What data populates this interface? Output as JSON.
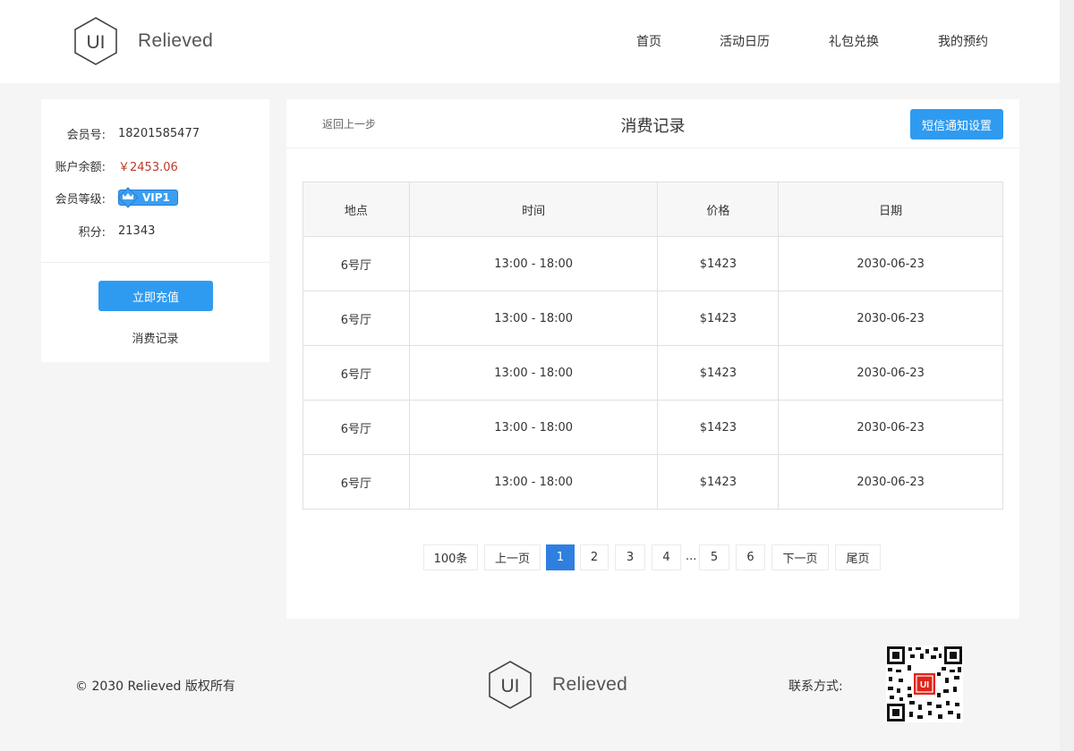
{
  "header": {
    "logo_mark": "UI",
    "logo_text": "Relieved",
    "nav": [
      {
        "label": "首页"
      },
      {
        "label": "活动日历"
      },
      {
        "label": "礼包兑换"
      },
      {
        "label": "我的预约"
      }
    ]
  },
  "member": {
    "id_label": "会员号:",
    "id_value": "18201585477",
    "balance_label": "账户余额:",
    "balance_value": "￥2453.06",
    "level_label": "会员等级:",
    "level_value": "VIP1",
    "points_label": "积分:",
    "points_value": "21343",
    "recharge_label": "立即充值",
    "records_link": "消费记录"
  },
  "main": {
    "back_label": "返回上一步",
    "title": "消费记录",
    "sms_label": "短信通知设置",
    "columns": [
      "地点",
      "时间",
      "价格",
      "日期"
    ],
    "rows": [
      [
        "6号厅",
        "13:00 - 18:00",
        "$1423",
        "2030-06-23"
      ],
      [
        "6号厅",
        "13:00 - 18:00",
        "$1423",
        "2030-06-23"
      ],
      [
        "6号厅",
        "13:00 - 18:00",
        "$1423",
        "2030-06-23"
      ],
      [
        "6号厅",
        "13:00 - 18:00",
        "$1423",
        "2030-06-23"
      ],
      [
        "6号厅",
        "13:00 - 18:00",
        "$1423",
        "2030-06-23"
      ]
    ]
  },
  "pager": {
    "total": "100条",
    "prev": "上一页",
    "pages": [
      "1",
      "2",
      "3",
      "4",
      "5",
      "6"
    ],
    "ellipsis": "...",
    "next": "下一页",
    "last": "尾页",
    "current": "1"
  },
  "footer": {
    "copyright": "© 2030 Relieved 版权所有",
    "logo_mark": "UI",
    "logo_text": "Relieved",
    "contact_label": "联系方式:",
    "qr_badge": "UI"
  },
  "colors": {
    "accent": "#2f9bf0",
    "active_page": "#2f7fe0",
    "money": "#c0392b"
  }
}
